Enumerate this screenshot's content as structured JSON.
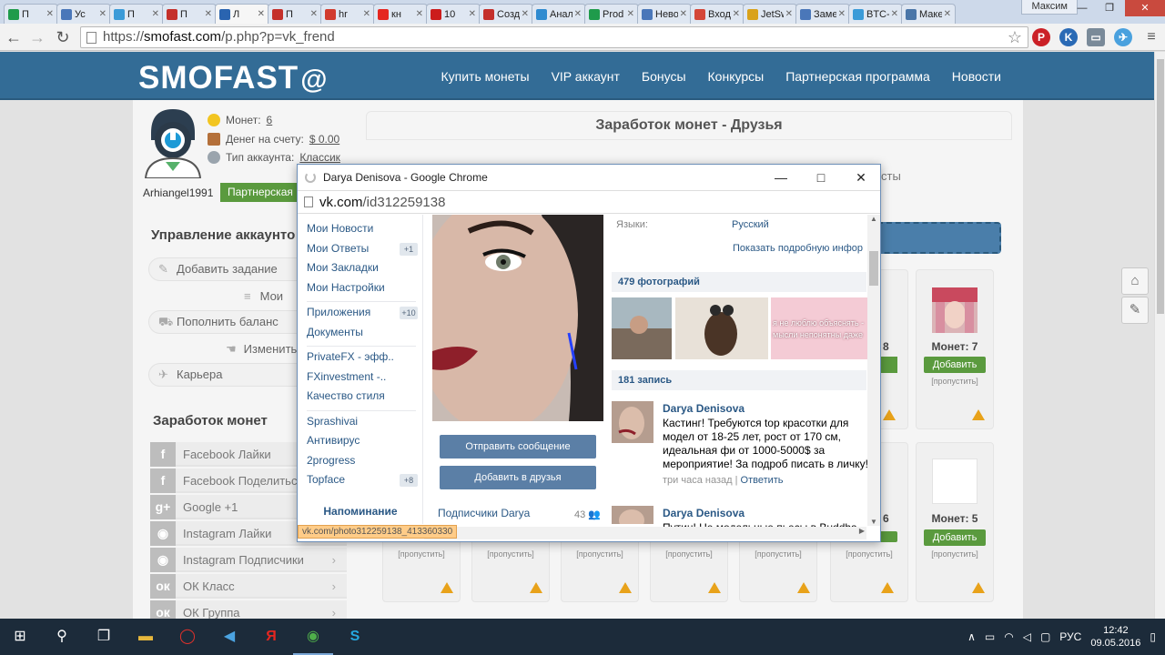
{
  "browser": {
    "tabs": [
      {
        "label": "П",
        "icon": "sheets-icon",
        "color": "#1f9b4b"
      },
      {
        "label": "Ус",
        "icon": "doc-icon",
        "color": "#4a77b9"
      },
      {
        "label": "П",
        "icon": "arrow-icon",
        "color": "#3b9bd8"
      },
      {
        "label": "П",
        "icon": "chart-icon",
        "color": "#c4302b"
      },
      {
        "label": "Л",
        "icon": "list-icon",
        "color": "#2a64b0"
      },
      {
        "label": "П",
        "icon": "chart-icon",
        "color": "#c4302b"
      },
      {
        "label": "hr",
        "icon": "rus-lat-icon",
        "color": "#d13b2e"
      },
      {
        "label": "кн",
        "icon": "yandex-icon",
        "color": "#e52620"
      },
      {
        "label": "10",
        "icon": "opera-icon",
        "color": "#cc1c1c"
      },
      {
        "label": "Созд",
        "icon": "question-icon",
        "color": "#c4302b"
      },
      {
        "label": "Анал",
        "icon": "graph-icon",
        "color": "#2f8bd0"
      },
      {
        "label": "Prod",
        "icon": "sheets-icon",
        "color": "#1f9b4b"
      },
      {
        "label": "Нево",
        "icon": "doc-icon",
        "color": "#4a77b9"
      },
      {
        "label": "Вход",
        "icon": "gmail-icon",
        "color": "#d44638"
      },
      {
        "label": "JetSw",
        "icon": "jet-icon",
        "color": "#d9a21b"
      },
      {
        "label": "Заме",
        "icon": "doc-icon",
        "color": "#4a77b9"
      },
      {
        "label": "BTC-",
        "icon": "arrow-icon",
        "color": "#3b9bd8"
      },
      {
        "label": "Маке",
        "icon": "vk-icon",
        "color": "#4a76a8"
      }
    ],
    "profile": "Максим",
    "url_scheme": "https://",
    "url_host": "smofast.com",
    "url_path": "/p.php?p=vk_frend"
  },
  "site": {
    "logo": "SMOFAST",
    "nav": [
      "Купить монеты",
      "VIP аккаунт",
      "Бонусы",
      "Конкурсы",
      "Партнерская программа",
      "Новости"
    ],
    "accent": "#336c96",
    "green": "#5a9a3e"
  },
  "account": {
    "coins_label": "Монет:",
    "coins": "6",
    "balance_label": "Денег на счету:",
    "balance": "$ 0.00",
    "type_label": "Тип аккаунта:",
    "type": "Классик",
    "username": "Arhiangel1991",
    "partner_button": "Партнерская п"
  },
  "sidebar": {
    "manage_title": "Управление аккаунто",
    "actions": [
      "Добавить задание",
      "Мои",
      "Пополнить баланс",
      "Изменить",
      "Карьера"
    ],
    "earn_title": "Заработок монет",
    "earn_items": [
      {
        "label": "Facebook Лайки",
        "icon": "facebook-icon",
        "glyph": "f"
      },
      {
        "label": "Facebook Поделиться",
        "icon": "facebook-icon",
        "glyph": "f"
      },
      {
        "label": "Google +1",
        "icon": "google-plus-icon",
        "glyph": "g+"
      },
      {
        "label": "Instagram Лайки",
        "icon": "instagram-icon",
        "glyph": "◉"
      },
      {
        "label": "Instagram Подписчики",
        "icon": "instagram-icon",
        "glyph": "◉"
      },
      {
        "label": "ОК Класс",
        "icon": "ok-icon",
        "glyph": "ок"
      },
      {
        "label": "ОК Группа",
        "icon": "ok-icon",
        "glyph": "ок"
      }
    ]
  },
  "main": {
    "title": "Заработок монет - Друзья",
    "tab_fragment": "сты",
    "cards": [
      {
        "coins": "Монет: 7",
        "add": "Добавить",
        "skip": "[пропустить]"
      },
      {
        "coins": "Монет: 5",
        "add": "Добавить",
        "skip": "[пропустить]"
      }
    ],
    "partial_coin_a": "8",
    "partial_coin_b": "6",
    "skip_label": "[пропустить]"
  },
  "popup": {
    "title": "Darya Denisova - Google Chrome",
    "url_host": "vk.com",
    "url_path": "/id312259138",
    "menu": [
      {
        "label": "Мои Новости",
        "badge": ""
      },
      {
        "label": "Мои Ответы",
        "badge": "+1"
      },
      {
        "label": "Мои Закладки",
        "badge": ""
      },
      {
        "label": "Мои Настройки",
        "badge": ""
      },
      {
        "label": "Приложения",
        "badge": "+10"
      },
      {
        "label": "Документы",
        "badge": ""
      },
      {
        "label": "PrivateFX - эфф..",
        "badge": ""
      },
      {
        "label": "FXinvestment -..",
        "badge": ""
      },
      {
        "label": "Качество стиля",
        "badge": ""
      },
      {
        "label": "Sprashivai",
        "badge": ""
      },
      {
        "label": "Антивирус",
        "badge": ""
      },
      {
        "label": "2progress",
        "badge": ""
      },
      {
        "label": "Topface",
        "badge": "+8"
      }
    ],
    "reminder": "Напоминание",
    "send_message": "Отправить сообщение",
    "add_friend": "Добавить в друзья",
    "subscribers": "Подписчики Darya",
    "subscribers_count": "43",
    "languages_label": "Языки:",
    "languages_value": "Русский",
    "show_more": "Показать подробную инфор",
    "photos_header": "479 фотографий",
    "photo_caption": "я не люблю объяснять - мысли непонятны даже",
    "posts_header": "181 запись",
    "posts": [
      {
        "name": "Darya Denisova",
        "text": "Кастинг! Требуются top красотки для модел от 18-25 лет, рост от 170 см, идеальная фи от 1000-5000$ за мероприятие! За подроб писать в личку!",
        "time": "три часа назад",
        "reply": "Ответить"
      },
      {
        "name": "Darya Denisova",
        "text": "Путин! Не модельные пьесы в Buddha ba",
        "time": "",
        "reply": ""
      }
    ],
    "status_link": "vk.com/photo312259138_413360330"
  },
  "taskbar": {
    "lang": "РУС",
    "time": "12:42",
    "date": "09.05.2016"
  }
}
